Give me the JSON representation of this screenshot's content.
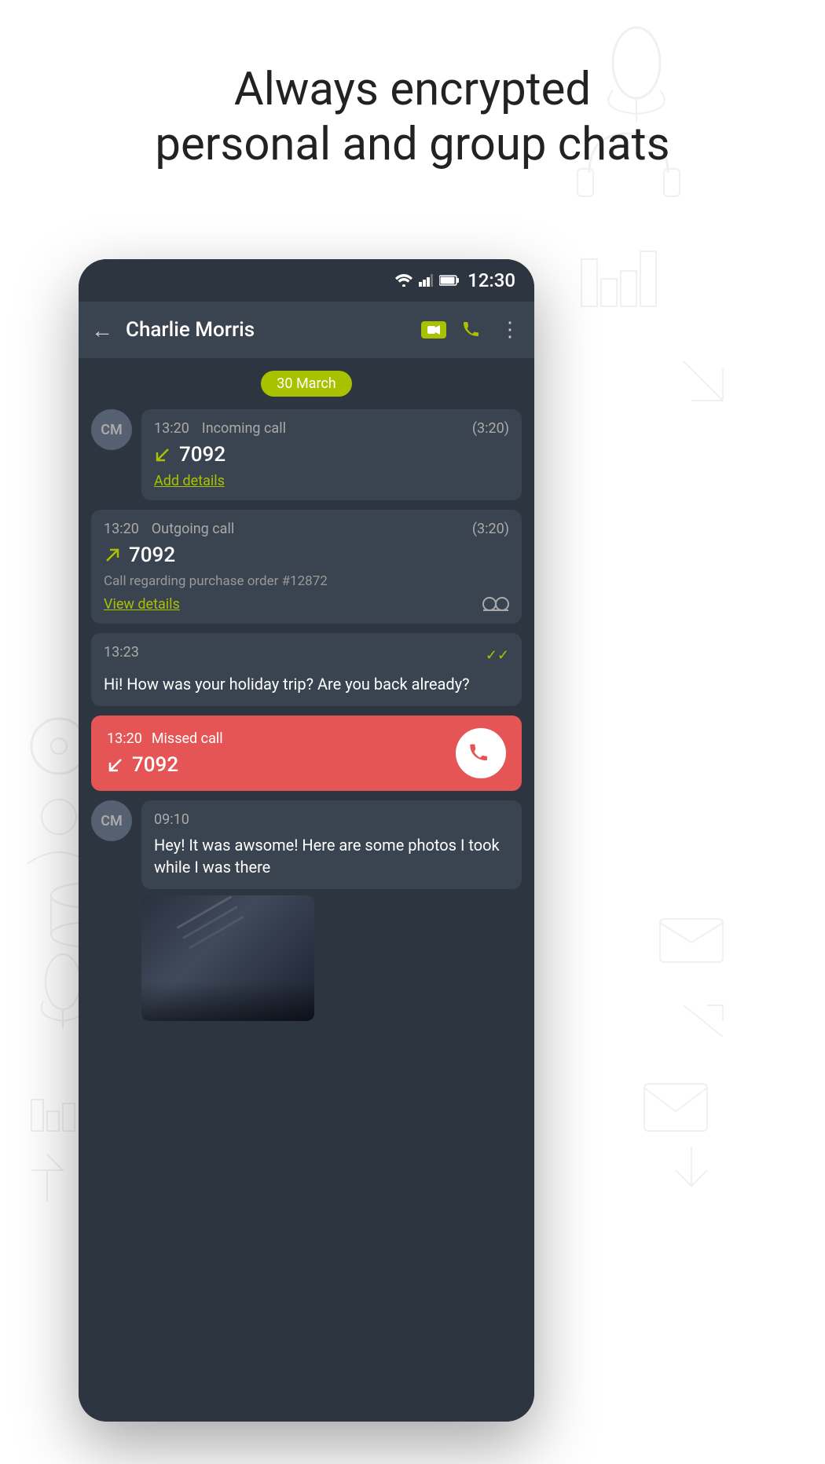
{
  "headline": {
    "line1": "Always encrypted",
    "line2": "personal and group chats"
  },
  "status_bar": {
    "time": "12:30"
  },
  "app_bar": {
    "contact_name": "Charlie Morris",
    "back_label": "←",
    "more_label": "⋮"
  },
  "date_badge": {
    "label": "30 March"
  },
  "messages": [
    {
      "id": "incoming-call-1",
      "type": "call",
      "direction": "incoming",
      "time": "13:20",
      "call_type": "Incoming call",
      "duration": "(3:20)",
      "number": "7092",
      "link_label": "Add details"
    },
    {
      "id": "outgoing-call-1",
      "type": "call",
      "direction": "outgoing",
      "time": "13:20",
      "call_type": "Outgoing call",
      "duration": "(3:20)",
      "number": "7092",
      "detail": "Call regarding purchase order #12872",
      "link_label": "View details"
    },
    {
      "id": "text-msg-1",
      "type": "text",
      "time": "13:23",
      "text": "Hi! How was your holiday trip? Are you back already?",
      "is_outgoing": true,
      "read": true
    },
    {
      "id": "missed-call-1",
      "type": "missed_call",
      "time": "13:20",
      "call_type": "Missed call",
      "number": "7092"
    },
    {
      "id": "text-msg-2",
      "type": "text_incoming",
      "time": "09:10",
      "text": "Hey! It was awsome! Here are some photos I took while I was there",
      "has_photo": true
    }
  ],
  "icons": {
    "back": "←",
    "more": "⋮",
    "phone": "📞",
    "incoming_arrow": "↙",
    "outgoing_arrow": "↗",
    "missed_arrow": "↙",
    "double_check": "✓✓",
    "voicemail": "⏺⏺",
    "callback_phone": "📞"
  },
  "colors": {
    "accent": "#a8c200",
    "missed_call_bg": "#e55555",
    "bubble_bg": "#3a4350",
    "app_bg": "#2d3540",
    "appbar_bg": "#3a4350",
    "white": "#ffffff",
    "muted": "#aaaaaa"
  },
  "avatar": {
    "initials": "CM"
  }
}
